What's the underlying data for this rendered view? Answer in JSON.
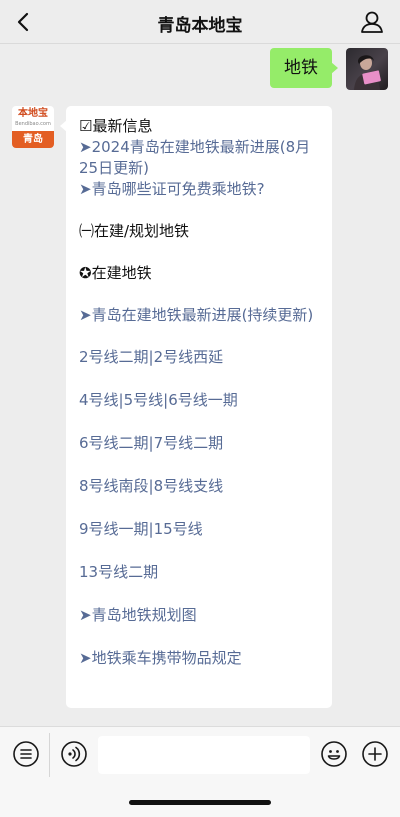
{
  "header": {
    "title": "青岛本地宝",
    "back_icon": "chevron-left-icon",
    "profile_icon": "person-icon"
  },
  "outgoing": {
    "text": "地铁"
  },
  "bot": {
    "logo_name": "本地宝",
    "logo_url": "Bendibao.com",
    "logo_city": "青岛"
  },
  "message": {
    "latest_heading": "☑最新信息",
    "latest_links": [
      "➤2024青岛在建地铁最新进展(8月25日更新)",
      "➤青岛哪些证可免费乘地铁?"
    ],
    "section_title": "㈠在建/规划地铁",
    "subsection_title": "✪在建地铁",
    "progress_link": "➤青岛在建地铁最新进展(持续更新)",
    "line_links": [
      "2号线二期|2号线西延",
      "4号线|5号线|6号线一期",
      "6号线二期|7号线二期",
      "8号线南段|8号线支线",
      "9号线一期|15号线",
      "13号线二期"
    ],
    "map_link": "➤青岛地铁规划图",
    "rules_link": "➤地铁乘车携带物品规定"
  },
  "inputbar": {
    "voice_icon": "voice-icon",
    "mic_icon": "audio-wave-icon",
    "emoji_icon": "emoji-icon",
    "add_icon": "plus-circle-icon"
  },
  "colors": {
    "link": "#576b95",
    "outgoing_bubble": "#95ec69",
    "background": "#ededed",
    "brand": "#e35e23"
  }
}
